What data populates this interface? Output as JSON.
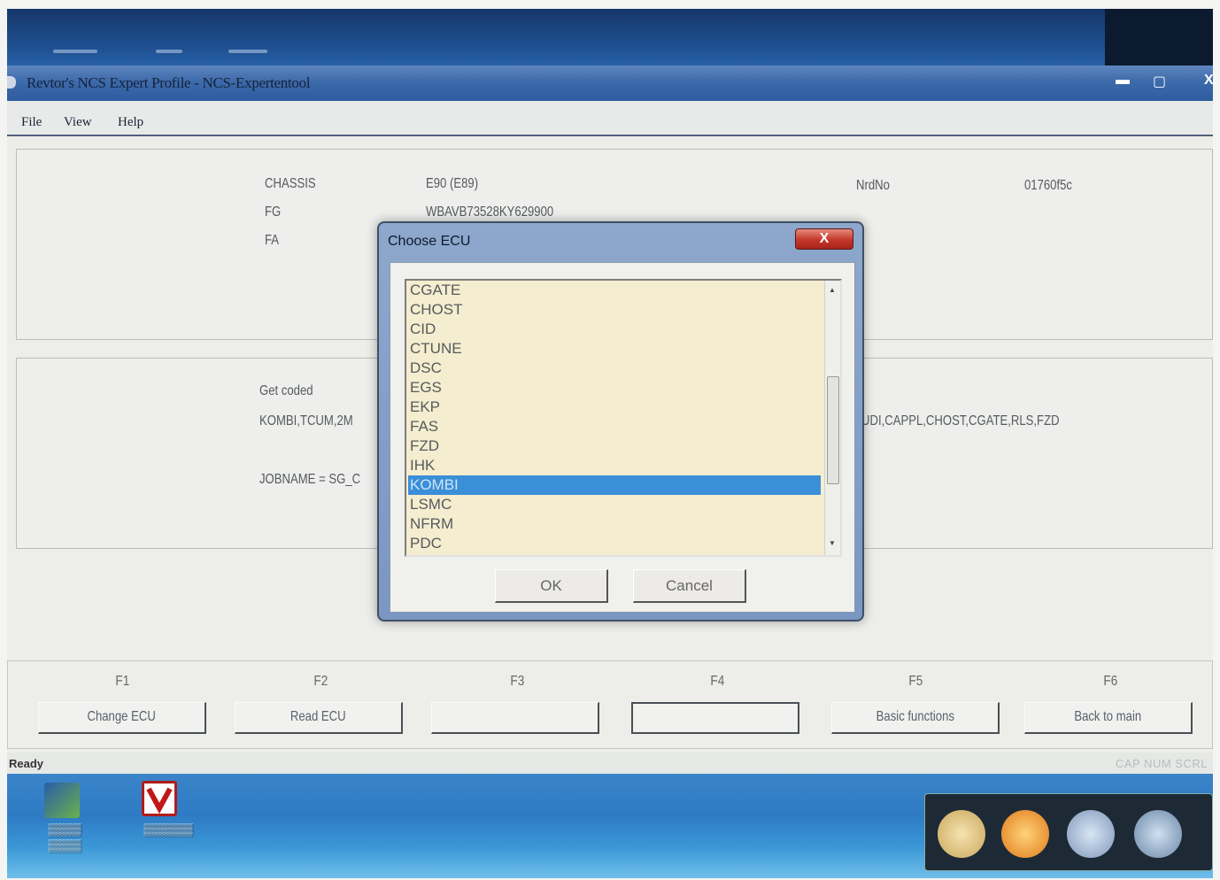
{
  "window": {
    "title": "Revtor's NCS Expert Profile - NCS-Expertentool",
    "minimize_glyph": "▬",
    "maximize_glyph": "▢",
    "close_glyph": "X"
  },
  "menu": {
    "file": "File",
    "view": "View",
    "help": "Help"
  },
  "info": {
    "chassis_label": "CHASSIS",
    "chassis_value": "E90 (E89)",
    "fg_label": "FG",
    "fg_value": "WBAVB73528KY629900",
    "fa_label": "FA",
    "nrno_label": "NrdNo",
    "nrno_value": "01760f5c"
  },
  "coding": {
    "get_coded_label": "Get coded",
    "coded_list_left": "KOMBI,TCUM,2M",
    "coded_list_right": "UDI,CAPPL,CHOST,CGATE,RLS,FZD",
    "jobname": "JOBNAME = SG_C"
  },
  "fkeys": [
    {
      "key": "F1",
      "label": "Change ECU"
    },
    {
      "key": "F2",
      "label": "Read ECU"
    },
    {
      "key": "F3",
      "label": ""
    },
    {
      "key": "F4",
      "label": ""
    },
    {
      "key": "F5",
      "label": "Basic functions"
    },
    {
      "key": "F6",
      "label": "Back to main"
    }
  ],
  "status": {
    "left": "Ready",
    "right": "CAP  NUM  SCRL"
  },
  "dialog": {
    "title": "Choose ECU",
    "close": "X",
    "items": [
      "CGATE",
      "CHOST",
      "CID",
      "CTUNE",
      "DSC",
      "EGS",
      "EKP",
      "FAS",
      "FZD",
      "IHK",
      "KOMBI",
      "LSMC",
      "NFRM",
      "PDC"
    ],
    "selected": "KOMBI",
    "ok_label": "OK",
    "cancel_label": "Cancel"
  },
  "colors": {
    "selection": "#3b8fd8",
    "list_bg": "#f4edcf",
    "titlebar": "#3d6aaa"
  }
}
